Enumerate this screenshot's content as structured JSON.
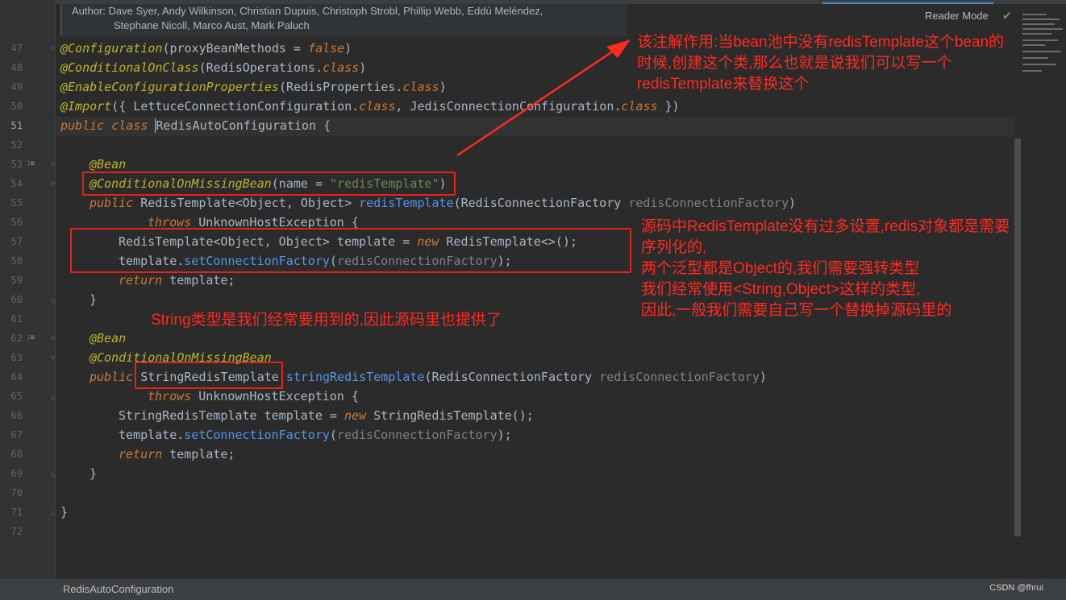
{
  "doc": {
    "line1": "Author: Dave Syer, Andy Wilkinson, Christian Dupuis, Christoph Strobl, Phillip Webb, Eddú Meléndez,",
    "line2": "Stephane Nicoll, Marco Aust, Mark Paluch"
  },
  "reader_mode": "Reader Mode",
  "code": {
    "l47": {
      "ann": "@Configuration",
      "p1": "(proxyBeanMethods = ",
      "val": "false",
      "p2": ")"
    },
    "l48": {
      "ann": "@ConditionalOnClass",
      "p1": "(RedisOperations.",
      "kw": "class",
      "p2": ")"
    },
    "l49": {
      "ann": "@EnableConfigurationProperties",
      "p1": "(RedisProperties.",
      "kw": "class",
      "p2": ")"
    },
    "l50": {
      "ann": "@Import",
      "p1": "({ LettuceConnectionConfiguration.",
      "kw1": "class",
      "p2": ", JedisConnectionConfiguration.",
      "kw2": "class",
      "p3": " })"
    },
    "l51": {
      "kw": "public class ",
      "name": "RedisAutoConfiguration",
      "p": " {"
    },
    "l53": {
      "ann": "@Bean"
    },
    "l54": {
      "ann": "@ConditionalOnMissingBean",
      "p1": "(name = ",
      "str": "\"redisTemplate\"",
      "p2": ")"
    },
    "l55": {
      "kw": "public ",
      "type": "RedisTemplate<Object, Object> ",
      "fn": "redisTemplate",
      "p1": "(RedisConnectionFactory ",
      "param": "redisConnectionFactory",
      "p2": ")"
    },
    "l56": {
      "kw": "throws ",
      "p": "UnknownHostException {"
    },
    "l57": {
      "p1": "RedisTemplate<Object, Object> template = ",
      "kw": "new ",
      "p2": "RedisTemplate<>();"
    },
    "l58": {
      "p1": "template.",
      "fn": "setConnectionFactory",
      "p2": "(",
      "param": "redisConnectionFactory",
      "p3": ");"
    },
    "l59": {
      "kw": "return ",
      "p": "template;"
    },
    "l60": {
      "p": "}"
    },
    "l62": {
      "ann": "@Bean"
    },
    "l63": {
      "ann": "@ConditionalOnMissingBean"
    },
    "l64": {
      "kw": "public ",
      "type": "StringRedisTemplate ",
      "fn": "stringRedisTemplate",
      "p1": "(RedisConnectionFactory ",
      "param": "redisConnectionFactory",
      "p2": ")"
    },
    "l65": {
      "kw": "throws ",
      "p": "UnknownHostException {"
    },
    "l66": {
      "p1": "StringRedisTemplate template = ",
      "kw": "new ",
      "p2": "StringRedisTemplate();"
    },
    "l67": {
      "p1": "template.",
      "fn": "setConnectionFactory",
      "p2": "(",
      "param": "redisConnectionFactory",
      "p3": ");"
    },
    "l68": {
      "kw": "return ",
      "p": "template;"
    },
    "l69": {
      "p": "}"
    },
    "l71": {
      "p": "}"
    }
  },
  "line_numbers": [
    "47",
    "48",
    "49",
    "50",
    "51",
    "52",
    "53",
    "54",
    "55",
    "56",
    "57",
    "58",
    "59",
    "60",
    "61",
    "62",
    "63",
    "64",
    "65",
    "66",
    "67",
    "68",
    "69",
    "70",
    "71",
    "72"
  ],
  "notes": {
    "n1": "该注解作用:当bean池中没有redisTemplate这个bean的\n时候,创建这个类,那么也就是说我们可以写一个\nredisTemplate来替换这个",
    "n2": "源码中RedisTemplate没有过多设置,redis对象都是需要\n序列化的,\n两个泛型都是Object的,我们需要强转类型\n我们经常使用<String,Object>这样的类型,\n因此,一般我们需要自己写一个替换掉源码里的",
    "n3": "String类型是我们经常要用到的,因此源码里也提供了"
  },
  "status": {
    "breadcrumb": "RedisAutoConfiguration",
    "watermark": "CSDN @fhrui"
  },
  "colors": {
    "annotation_red": "#e2231a",
    "keyword": "#cc7832",
    "annotation": "#bbb529",
    "string": "#6a8759",
    "method": "#5394ec"
  }
}
